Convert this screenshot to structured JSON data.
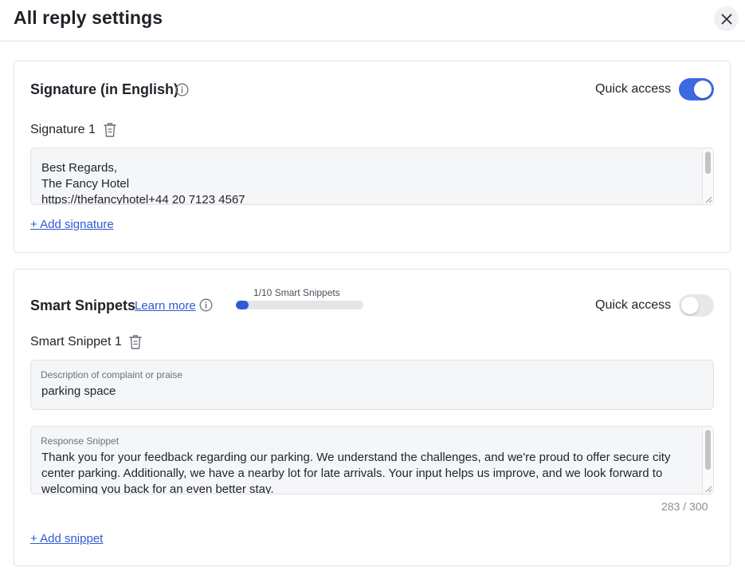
{
  "header": {
    "title": "All reply settings",
    "close_icon": "close-icon"
  },
  "signature": {
    "title": "Signature (in English)",
    "quick_access_label": "Quick access",
    "quick_access_on": true,
    "item_label": "Signature 1",
    "text": "Best Regards,\nThe Fancy Hotel\nhttps://thefancyhotel+44 20 7123 4567",
    "add_link": "+ Add signature"
  },
  "snippets": {
    "title": "Smart Snippets",
    "learn_more": "Learn more",
    "progress_label": "1/10 Smart Snippets",
    "progress_fraction": 0.1,
    "quick_access_label": "Quick access",
    "quick_access_on": false,
    "item_label": "Smart Snippet 1",
    "description_label": "Description of complaint or praise",
    "description_value": "parking space",
    "response_label": "Response Snippet",
    "response_value": "Thank you for your feedback regarding our parking. We understand the challenges, and we're proud to offer secure city center parking. Additionally, we have a nearby lot for late arrivals. Your input helps us improve, and we look forward to welcoming you back for an even better stay.",
    "counter": "283 / 300",
    "add_link": "+ Add snippet"
  },
  "colors": {
    "accent": "#3d6ae0",
    "link": "#2f5bd6",
    "field_bg": "#f5f6f8"
  }
}
